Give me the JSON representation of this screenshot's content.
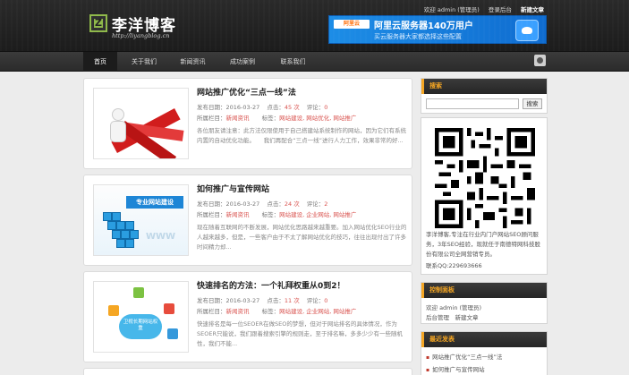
{
  "site": {
    "logo_mark": "Z",
    "title": "李洋博客",
    "subtitle": "http://liyangblog.cn"
  },
  "toplinks": {
    "welcome": "欢迎 admin (管理员)",
    "logout": "登录后台",
    "new_post": "新建文章"
  },
  "banner": {
    "logo": "阿里云",
    "line1": "阿里云服务器140万用户",
    "line2": "买云服务器大家都选择这些配置"
  },
  "nav": {
    "items": [
      "首页",
      "关于我们",
      "新闻资讯",
      "成功案例",
      "联系我们"
    ]
  },
  "posts": [
    {
      "title": "网站推广优化“三点一线”法",
      "date_label": "发布日期：",
      "date": "2016-03-27",
      "views_label": "点击：",
      "views": "45 次",
      "comments_label": "评论：",
      "comments": "0",
      "category_label": "所属栏目：",
      "category": "新闻资讯",
      "tags_label": "标签：",
      "tags": "网站建设, 网站优化, 网站推广",
      "excerpt": "各位朋友请注意：此方法仅限使用于自己搭建站系统制作的网站，因为它们有系统内置的自动优化功能。　　我们再配合“三点一线”进行人力工作，效果非常的好..."
    },
    {
      "title": "如何推广与宣传网站",
      "date_label": "发布日期：",
      "date": "2016-03-27",
      "views_label": "点击：",
      "views": "24 次",
      "comments_label": "评论：",
      "comments": "2",
      "category_label": "所属栏目：",
      "category": "新闻资讯",
      "tags_label": "标签：",
      "tags": "网站建设, 企业网站, 网站推广",
      "excerpt": "现在随着互联网的不断发展，网站优化思路越来越重要。加入网站优化SEO行业的人越来越多，但是，一些客户由于不太了解网站优化的技巧，往往出现付出了许多时间精力却..."
    },
    {
      "title": "快速排名的方法：一个礼拜权重从0到2！",
      "date_label": "发布日期：",
      "date": "2016-03-27",
      "views_label": "点击：",
      "views": "11 次",
      "comments_label": "评论：",
      "comments": "0",
      "category_label": "所属栏目：",
      "category": "新闻资讯",
      "tags_label": "标签：",
      "tags": "网站建设, 企业网站, 网站推广",
      "excerpt": "快速排名是每一位SEOER在做SEO的梦想，但对于网站排名的具体情况，作为SEOER只能说，我们跟着搜索引擎的规则走，至于排名嘛，多多少少有一些随机性，我们不能..."
    }
  ],
  "thumbs": {
    "post2_label": "专业网站建设",
    "post2_www": "WWW",
    "post3_cloud": "卫视长期网站权重"
  },
  "sidebar": {
    "search": {
      "heading": "搜索",
      "button": "搜索"
    },
    "about": {
      "text": "李洋博客,专注在行业内门户网站SEO顾问服务，3年SEO经验，现就任于南德特网科技股份有限公司全网营销专员。",
      "qq": "联系QQ:229693666"
    },
    "control": {
      "heading": "控制面板",
      "welcome": "欢迎 admin (管理员)",
      "links": "后台管理　新建文章"
    },
    "recent": {
      "heading": "最近发表",
      "items": [
        "网站推广优化“三点一线”法",
        "如何推广与宣传网站"
      ]
    }
  }
}
